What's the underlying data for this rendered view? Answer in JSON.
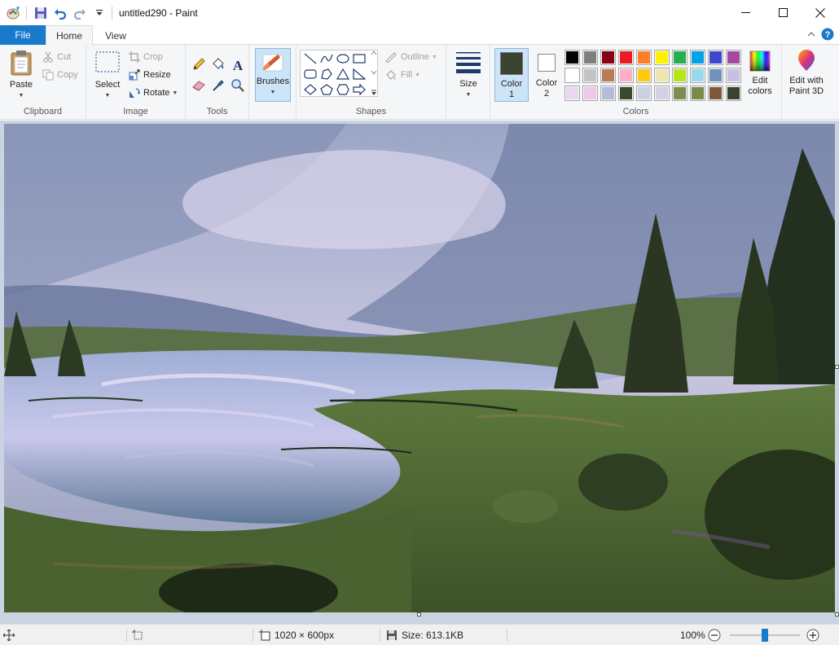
{
  "window": {
    "title": "untitled290 - Paint"
  },
  "tabs": {
    "file": "File",
    "home": "Home",
    "view": "View"
  },
  "clipboard": {
    "paste": "Paste",
    "cut": "Cut",
    "copy": "Copy",
    "label": "Clipboard"
  },
  "image": {
    "select": "Select",
    "crop": "Crop",
    "resize": "Resize",
    "rotate": "Rotate",
    "label": "Image"
  },
  "tools": {
    "label": "Tools",
    "brushes": "Brushes"
  },
  "shapes": {
    "outline": "Outline",
    "fill": "Fill",
    "label": "Shapes"
  },
  "size": {
    "label": "Size"
  },
  "colors": {
    "color1_line1": "Color",
    "color1_line2": "1",
    "color2_line1": "Color",
    "color2_line2": "2",
    "edit_line1": "Edit",
    "edit_line2": "colors",
    "paint3d_line1": "Edit with",
    "paint3d_line2": "Paint 3D",
    "label": "Colors",
    "color1_value": "#3a4230",
    "color2_value": "#ffffff",
    "row1": [
      "#000000",
      "#7f7f7f",
      "#880015",
      "#ed1c24",
      "#ff7f27",
      "#fff200",
      "#22b14c",
      "#00a2e8",
      "#3f48cc",
      "#a349a4"
    ],
    "row2": [
      "#ffffff",
      "#c3c3c3",
      "#b97a57",
      "#ffaec9",
      "#ffc90e",
      "#efe4b0",
      "#b5e61d",
      "#99d9ea",
      "#7092be",
      "#c8bfe7"
    ],
    "row3": [
      "#e8d8ee",
      "#eec8e8",
      "#b4bcdc",
      "#3a4a2a",
      "#c8d0e4",
      "#d4d0e8",
      "#7e8c50",
      "#7a8a48",
      "#7e5a3a",
      "#3a4230"
    ]
  },
  "status": {
    "dimensions": "1020 × 600px",
    "size": "Size: 613.1KB",
    "zoom": "100%",
    "zoom_fraction": 0.5
  }
}
